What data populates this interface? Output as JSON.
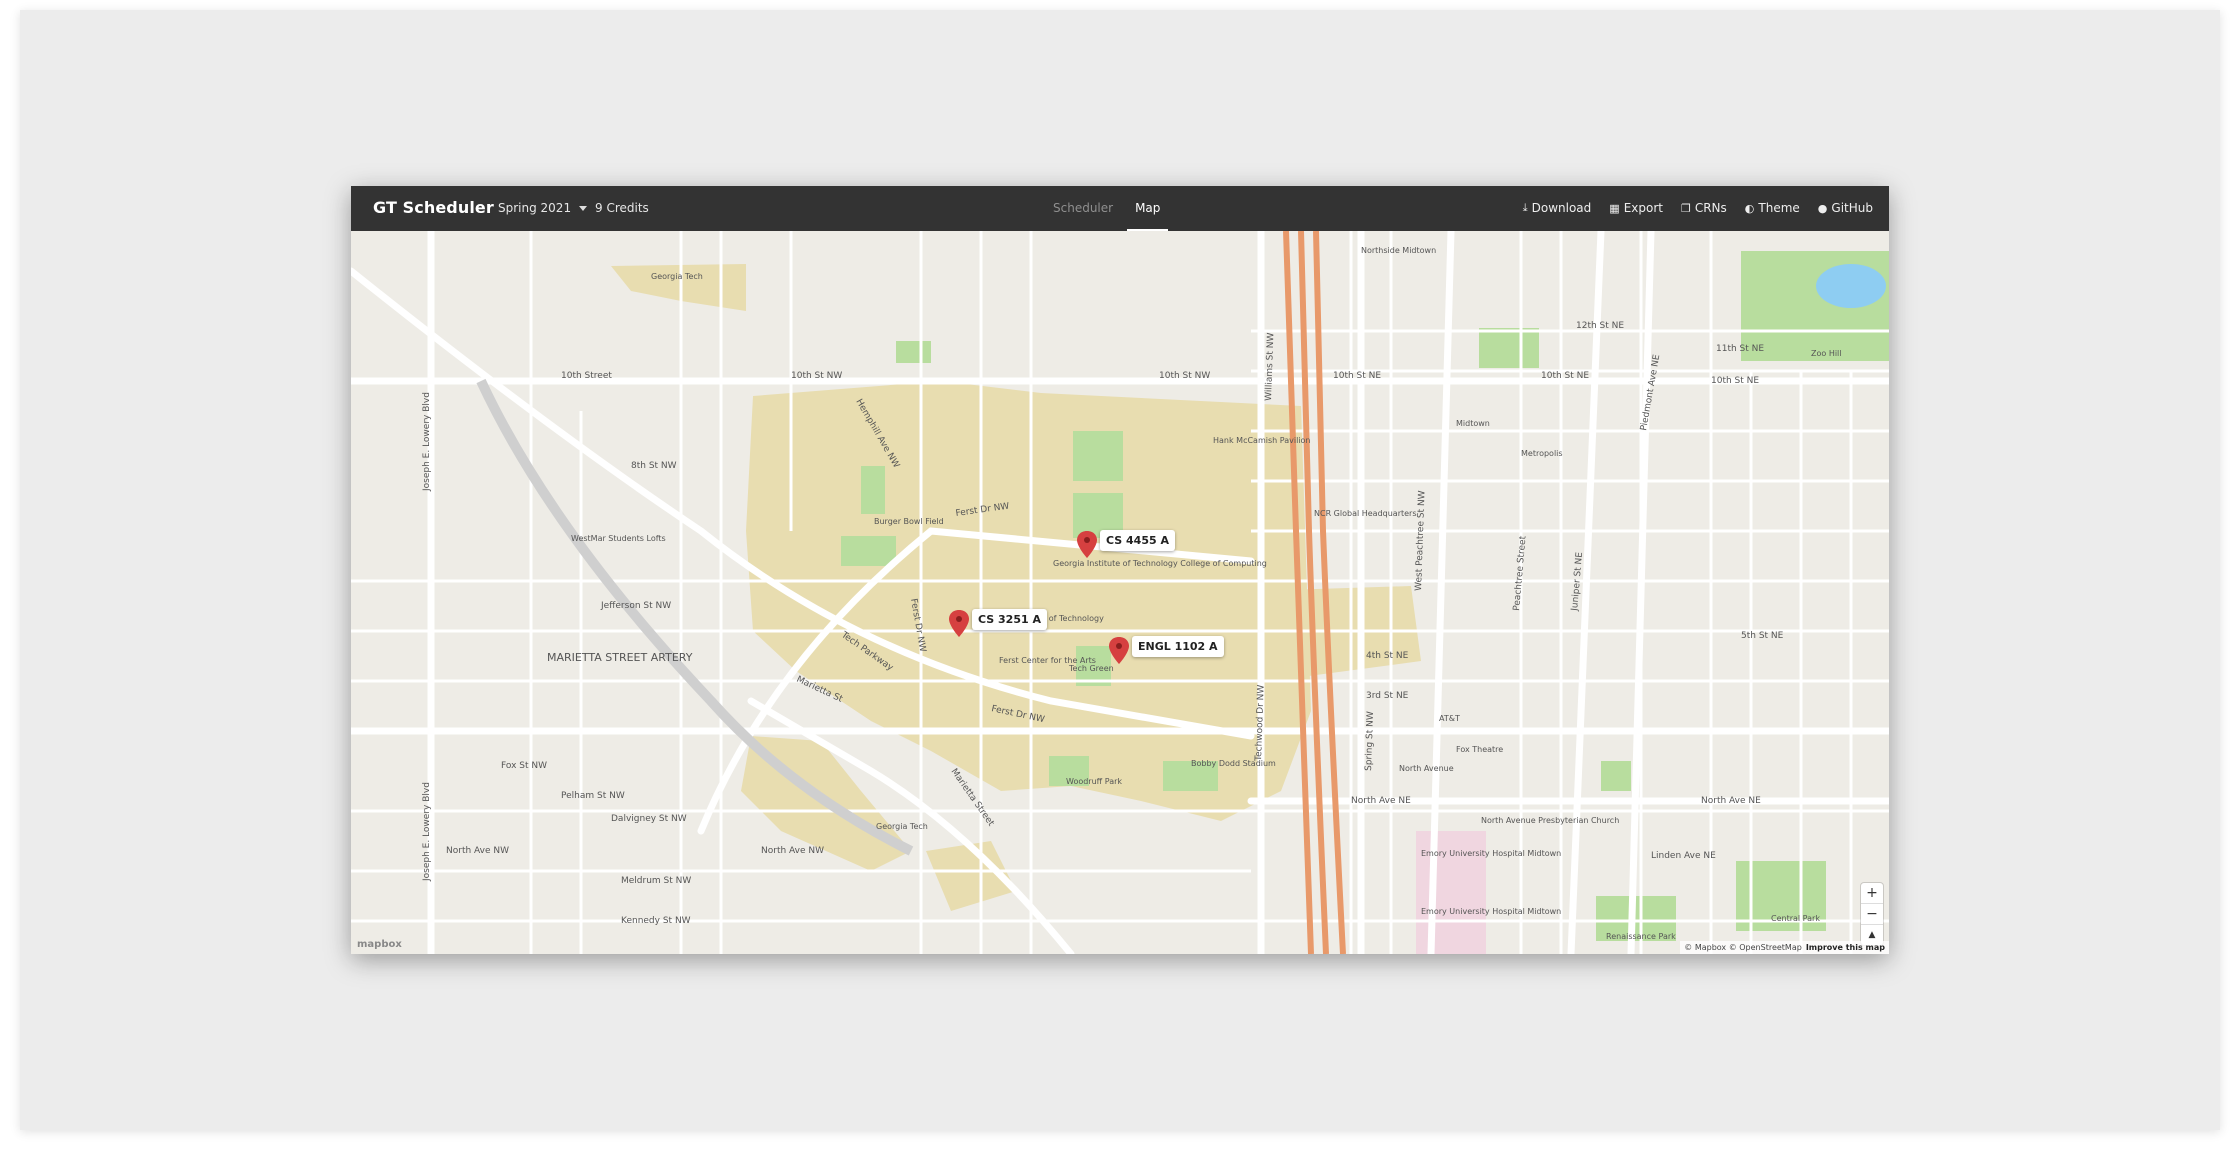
{
  "navbar": {
    "brand": "GT Scheduler",
    "term": "Spring 2021",
    "credits": "9 Credits",
    "tabs": [
      {
        "label": "Scheduler",
        "active": false
      },
      {
        "label": "Map",
        "active": true
      }
    ],
    "actions": [
      {
        "label": "Download",
        "icon": "download-icon"
      },
      {
        "label": "Export",
        "icon": "calendar-icon"
      },
      {
        "label": "CRNs",
        "icon": "copy-icon"
      },
      {
        "label": "Theme",
        "icon": "adjust-icon"
      },
      {
        "label": "GitHub",
        "icon": "github-icon"
      }
    ]
  },
  "map": {
    "markers": [
      {
        "label": "CS 4455 A"
      },
      {
        "label": "CS 3251 A"
      },
      {
        "label": "ENGL 1102 A"
      }
    ],
    "streets": {
      "s10th_nw": "10th St NW",
      "s10th": "10th Street",
      "s10th_ne": "10th St NE",
      "s10th_ne2": "10th St NE",
      "s10th_nw2": "10th St NW",
      "ferst_nw": "Ferst Dr NW",
      "ferst_nw2": "Ferst Dr NW",
      "ferst_nw3": "Ferst Dr NW",
      "north_ave_ne": "North Ave NE",
      "north_ave_ne2": "North Ave NE",
      "north_ave_nw": "North Ave NW",
      "north_ave_nw2": "North Ave NW",
      "marietta": "Marietta Street",
      "marietta2": "Marietta St",
      "williams": "Williams St NW",
      "spring": "Spring St NW",
      "w_peachtree": "West Peachtree St NW",
      "peachtree": "Peachtree Street",
      "juniper": "Juniper St NE",
      "piedmont": "Piedmont Ave NE",
      "lowery": "Joseph E. Lowery Blvd",
      "lowery2": "Joseph E. Lowery Blvd",
      "jefferson": "Jefferson St NW",
      "s8th": "8th St NW",
      "s5th": "5th St NE",
      "s4th": "4th St NE",
      "s3rd": "3rd St NE",
      "fox": "Fox St NW",
      "pelham": "Pelham St NW",
      "dalvigney": "Dalvigney St NW",
      "meldrum": "Meldrum St NW",
      "kennedy": "Kennedy St NW",
      "tech_pkwy": "Tech Parkway",
      "techwood": "Techwood Dr NW",
      "hemphill": "Hemphill Ave NW",
      "linden": "Linden Ave NE",
      "s12th": "12th St NE",
      "s11th": "11th St NE"
    },
    "pois": {
      "gatech_top": "Georgia Tech",
      "gatech_bottom": "Georgia Tech",
      "burger_bowl": "Burger Bowl Field",
      "tech_green": "Tech Green",
      "woodruff": "Woodruff Park",
      "bobby_dodd": "Bobby Dodd Stadium",
      "ferst_center": "Ferst Center for the Arts",
      "mccamish": "Hank McCamish Pavilion",
      "college_computing": "Georgia Institute of Technology College of Computing",
      "gatech_inst": "Institute of Technology",
      "ncr": "NCR Global Headquarters",
      "westmar": "WestMar Students Lofts",
      "marietta_artery": "MARIETTA STREET ARTERY",
      "midtown": "Midtown",
      "north_avenue": "North Avenue",
      "fox_theatre": "Fox Theatre",
      "att": "AT&T",
      "emory": "Emory University Hospital Midtown",
      "emory2": "Emory University Hospital Midtown",
      "npc": "North Avenue Presbyterian Church",
      "central_park": "Central Park",
      "renaissance": "Renaissance Park",
      "zoo_hill": "Zoo Hill",
      "northside": "Northside Midtown",
      "metropolis": "Metropolis"
    },
    "attribution": "© Mapbox © OpenStreetMap",
    "improve": "Improve this map",
    "logo": "mapbox"
  }
}
